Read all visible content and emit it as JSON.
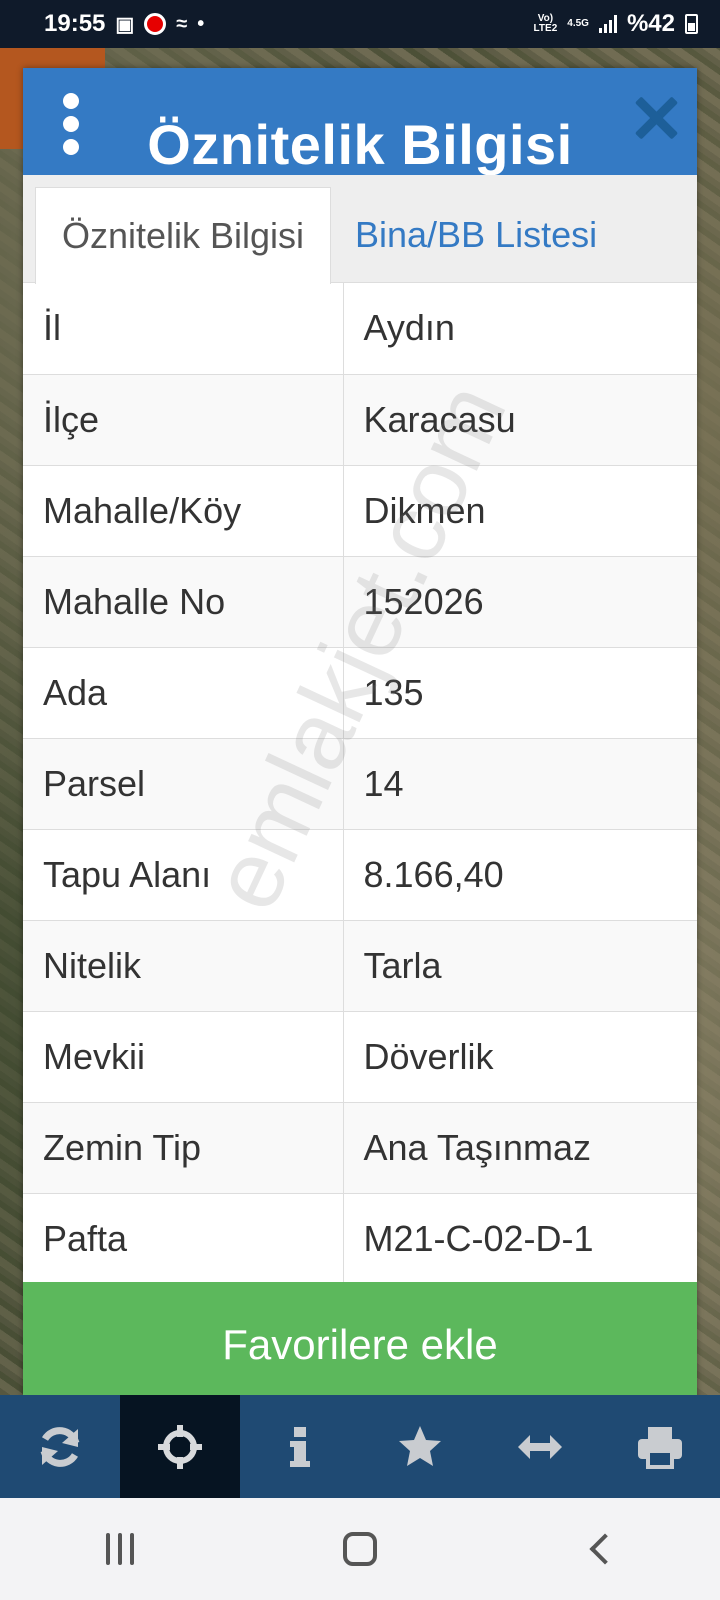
{
  "status_bar": {
    "time": "19:55",
    "network_top": "Vo)",
    "network_bottom": "LTE2",
    "network_type": "4.5G",
    "battery": "%42"
  },
  "modal": {
    "title": "Öznitelik Bilgisi",
    "tabs": [
      {
        "label": "Öznitelik Bilgisi",
        "active": true
      },
      {
        "label": "Bina/BB Listesi",
        "active": false
      }
    ],
    "rows": [
      {
        "key": "İl",
        "value": "Aydın"
      },
      {
        "key": "İlçe",
        "value": "Karacasu"
      },
      {
        "key": "Mahalle/Köy",
        "value": "Dikmen"
      },
      {
        "key": "Mahalle No",
        "value": "152026"
      },
      {
        "key": "Ada",
        "value": "135"
      },
      {
        "key": "Parsel",
        "value": "14"
      },
      {
        "key": "Tapu Alanı",
        "value": "8.166,40"
      },
      {
        "key": "Nitelik",
        "value": "Tarla"
      },
      {
        "key": "Mevkii",
        "value": "Döverlik"
      },
      {
        "key": "Zemin Tip",
        "value": "Ana Taşınmaz"
      },
      {
        "key": "Pafta",
        "value": "M21-C-02-D-1"
      }
    ],
    "favorite_button": "Favorilere ekle"
  },
  "watermark": "emlakjet.com",
  "toolbar": {
    "items": [
      {
        "icon": "refresh-icon"
      },
      {
        "icon": "crosshair-icon",
        "active": true
      },
      {
        "icon": "info-icon"
      },
      {
        "icon": "star-icon"
      },
      {
        "icon": "resize-horizontal-icon"
      },
      {
        "icon": "print-icon"
      }
    ]
  },
  "colors": {
    "header": "#347ac4",
    "tab_link": "#347ac4",
    "favorite": "#5cb85c",
    "toolbar": "#1f4a73"
  }
}
